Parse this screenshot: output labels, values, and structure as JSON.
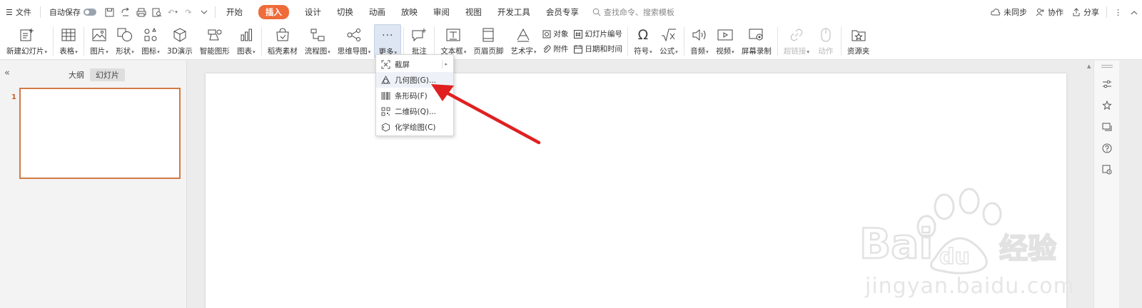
{
  "menubar": {
    "menu_label": "文件",
    "autosave_label": "自动保存",
    "tabs": [
      {
        "label": "开始"
      },
      {
        "label": "插入"
      },
      {
        "label": "设计"
      },
      {
        "label": "切换"
      },
      {
        "label": "动画"
      },
      {
        "label": "放映"
      },
      {
        "label": "审阅"
      },
      {
        "label": "视图"
      },
      {
        "label": "开发工具"
      },
      {
        "label": "会员专享"
      }
    ],
    "active_tab": "插入",
    "search_placeholder": "查找命令、搜索模板",
    "right": {
      "sync": "未同步",
      "collab": "协作",
      "share": "分享"
    }
  },
  "ribbon": {
    "new_slide": "新建幻灯片",
    "table": "表格",
    "picture": "图片",
    "shape": "形状",
    "icon": "图标",
    "three_d": "3D演示",
    "smartart": "智能图形",
    "chart": "图表",
    "docer": "稻壳素材",
    "flowchart": "流程图",
    "mindmap": "思维导图",
    "more": "更多",
    "comment": "批注",
    "textbox": "文本框",
    "header_footer": "页眉页脚",
    "wordart": "艺术字",
    "object": "对象",
    "slide_number": "幻灯片编号",
    "attachment": "附件",
    "datetime": "日期和时间",
    "symbol": "符号",
    "formula": "公式",
    "audio": "音频",
    "video": "视频",
    "screen_record": "屏幕录制",
    "hyperlink": "超链接",
    "action": "动作",
    "resources": "资源夹"
  },
  "leftpane": {
    "tab_outline": "大纲",
    "tab_slides": "幻灯片",
    "slide_number": "1"
  },
  "dropdown": {
    "items": [
      {
        "label": "截屏",
        "icon": "screenshot-icon",
        "has_submenu": true
      },
      {
        "label": "几何图(G)...",
        "icon": "geometry-icon"
      },
      {
        "label": "条形码(F)",
        "icon": "barcode-icon"
      },
      {
        "label": "二维码(Q)...",
        "icon": "qrcode-icon"
      },
      {
        "label": "化学绘图(C)",
        "icon": "chemistry-icon"
      }
    ]
  },
  "watermark": {
    "text": "jingyan.baidu.com",
    "logo_text": "Bai du 经验"
  },
  "colors": {
    "accent": "#ef6b3a",
    "arrow": "#e02020",
    "thumb_border": "#d17a45"
  }
}
